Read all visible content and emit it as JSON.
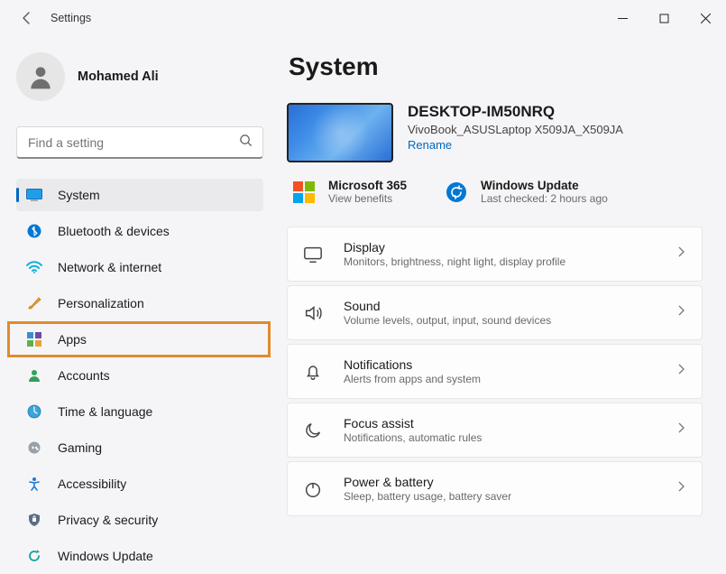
{
  "titlebar": {
    "title": "Settings"
  },
  "user": {
    "name": "Mohamed Ali"
  },
  "search": {
    "placeholder": "Find a setting"
  },
  "nav": [
    {
      "label": "System"
    },
    {
      "label": "Bluetooth & devices"
    },
    {
      "label": "Network & internet"
    },
    {
      "label": "Personalization"
    },
    {
      "label": "Apps"
    },
    {
      "label": "Accounts"
    },
    {
      "label": "Time & language"
    },
    {
      "label": "Gaming"
    },
    {
      "label": "Accessibility"
    },
    {
      "label": "Privacy & security"
    },
    {
      "label": "Windows Update"
    }
  ],
  "page": {
    "title": "System",
    "device": {
      "name": "DESKTOP-IM50NRQ",
      "model": "VivoBook_ASUSLaptop X509JA_X509JA",
      "rename": "Rename"
    },
    "promo": {
      "ms365": {
        "title": "Microsoft 365",
        "sub": "View benefits"
      },
      "update": {
        "title": "Windows Update",
        "sub": "Last checked: 2 hours ago"
      }
    },
    "cards": [
      {
        "title": "Display",
        "sub": "Monitors, brightness, night light, display profile"
      },
      {
        "title": "Sound",
        "sub": "Volume levels, output, input, sound devices"
      },
      {
        "title": "Notifications",
        "sub": "Alerts from apps and system"
      },
      {
        "title": "Focus assist",
        "sub": "Notifications, automatic rules"
      },
      {
        "title": "Power & battery",
        "sub": "Sleep, battery usage, battery saver"
      }
    ]
  }
}
